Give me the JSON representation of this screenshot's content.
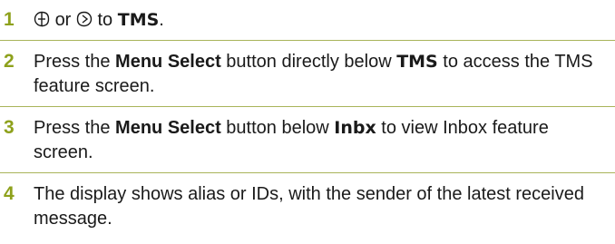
{
  "steps": [
    {
      "number": "1",
      "icon_left": "scroll-left-icon",
      "word_or": "or",
      "icon_right": "scroll-right-icon",
      "word_to": "to",
      "target": "TMS",
      "end": "."
    },
    {
      "number": "2",
      "pre": "Press the ",
      "bold": "Menu Select",
      "mid": " button directly below ",
      "display": "TMS",
      "post": " to access the TMS feature screen."
    },
    {
      "number": "3",
      "pre": "Press the ",
      "bold": "Menu Select",
      "mid": " button below ",
      "display": "Inbx",
      "post": " to view Inbox feature screen."
    },
    {
      "number": "4",
      "text": "The display shows alias or IDs, with the sender of the latest received message."
    }
  ],
  "colors": {
    "step_number": "#8ea11c",
    "rule": "#a9b45a",
    "text": "#1a1a1a"
  }
}
